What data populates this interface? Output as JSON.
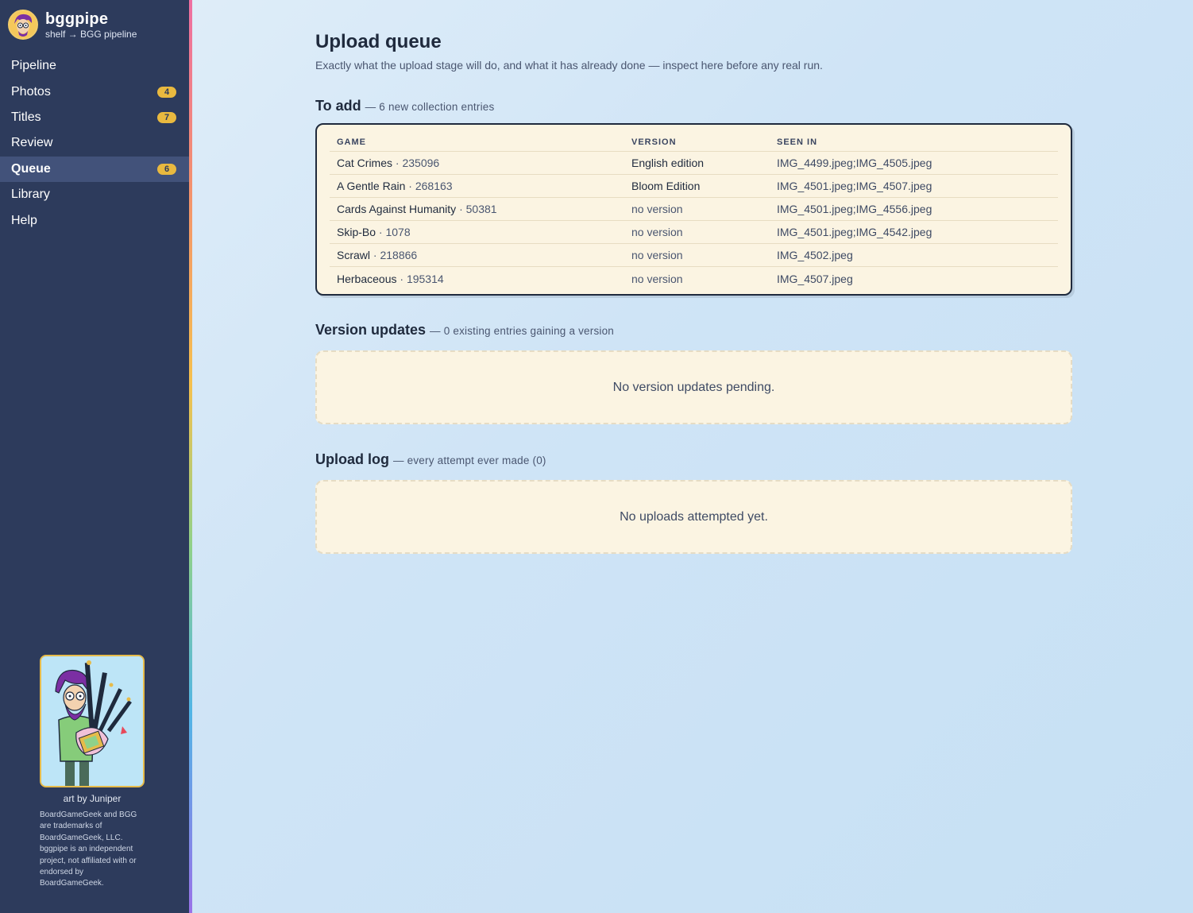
{
  "brand": {
    "name": "bggpipe",
    "subtitle": "shelf → BGG pipeline"
  },
  "nav": [
    {
      "label": "Pipeline",
      "badge": null,
      "active": false
    },
    {
      "label": "Photos",
      "badge": "4",
      "active": false
    },
    {
      "label": "Titles",
      "badge": "7",
      "active": false
    },
    {
      "label": "Review",
      "badge": null,
      "active": false
    },
    {
      "label": "Queue",
      "badge": "6",
      "active": true
    },
    {
      "label": "Library",
      "badge": null,
      "active": false
    },
    {
      "label": "Help",
      "badge": null,
      "active": false
    }
  ],
  "art_credit": "art by Juniper",
  "disclaimer": "BoardGameGeek and BGG are trademarks of BoardGameGeek, LLC. bggpipe is an independent project, not affiliated with or endorsed by BoardGameGeek.",
  "page": {
    "title": "Upload queue",
    "subtitle": "Exactly what the upload stage will do, and what it has already done — inspect here before any real run."
  },
  "to_add": {
    "title": "To add",
    "meta": "— 6 new collection entries",
    "columns": [
      "GAME",
      "VERSION",
      "SEEN IN"
    ],
    "rows": [
      {
        "game": "Cat Crimes",
        "id": "235096",
        "version": "English edition",
        "has_version": true,
        "seen_in": "IMG_4499.jpeg;IMG_4505.jpeg"
      },
      {
        "game": "A Gentle Rain",
        "id": "268163",
        "version": "Bloom Edition",
        "has_version": true,
        "seen_in": "IMG_4501.jpeg;IMG_4507.jpeg"
      },
      {
        "game": "Cards Against Humanity",
        "id": "50381",
        "version": "no version",
        "has_version": false,
        "seen_in": "IMG_4501.jpeg;IMG_4556.jpeg"
      },
      {
        "game": "Skip-Bo",
        "id": "1078",
        "version": "no version",
        "has_version": false,
        "seen_in": "IMG_4501.jpeg;IMG_4542.jpeg"
      },
      {
        "game": "Scrawl",
        "id": "218866",
        "version": "no version",
        "has_version": false,
        "seen_in": "IMG_4502.jpeg"
      },
      {
        "game": "Herbaceous",
        "id": "195314",
        "version": "no version",
        "has_version": false,
        "seen_in": "IMG_4507.jpeg"
      }
    ]
  },
  "version_updates": {
    "title": "Version updates",
    "meta": "— 0 existing entries gaining a version",
    "empty": "No version updates pending."
  },
  "upload_log": {
    "title": "Upload log",
    "meta": "— every attempt ever made (0)",
    "empty": "No uploads attempted yet."
  },
  "colors": {
    "sidebar": "#2d3b5c",
    "accent_badge": "#e9b93f",
    "card": "#fbf4e2"
  }
}
